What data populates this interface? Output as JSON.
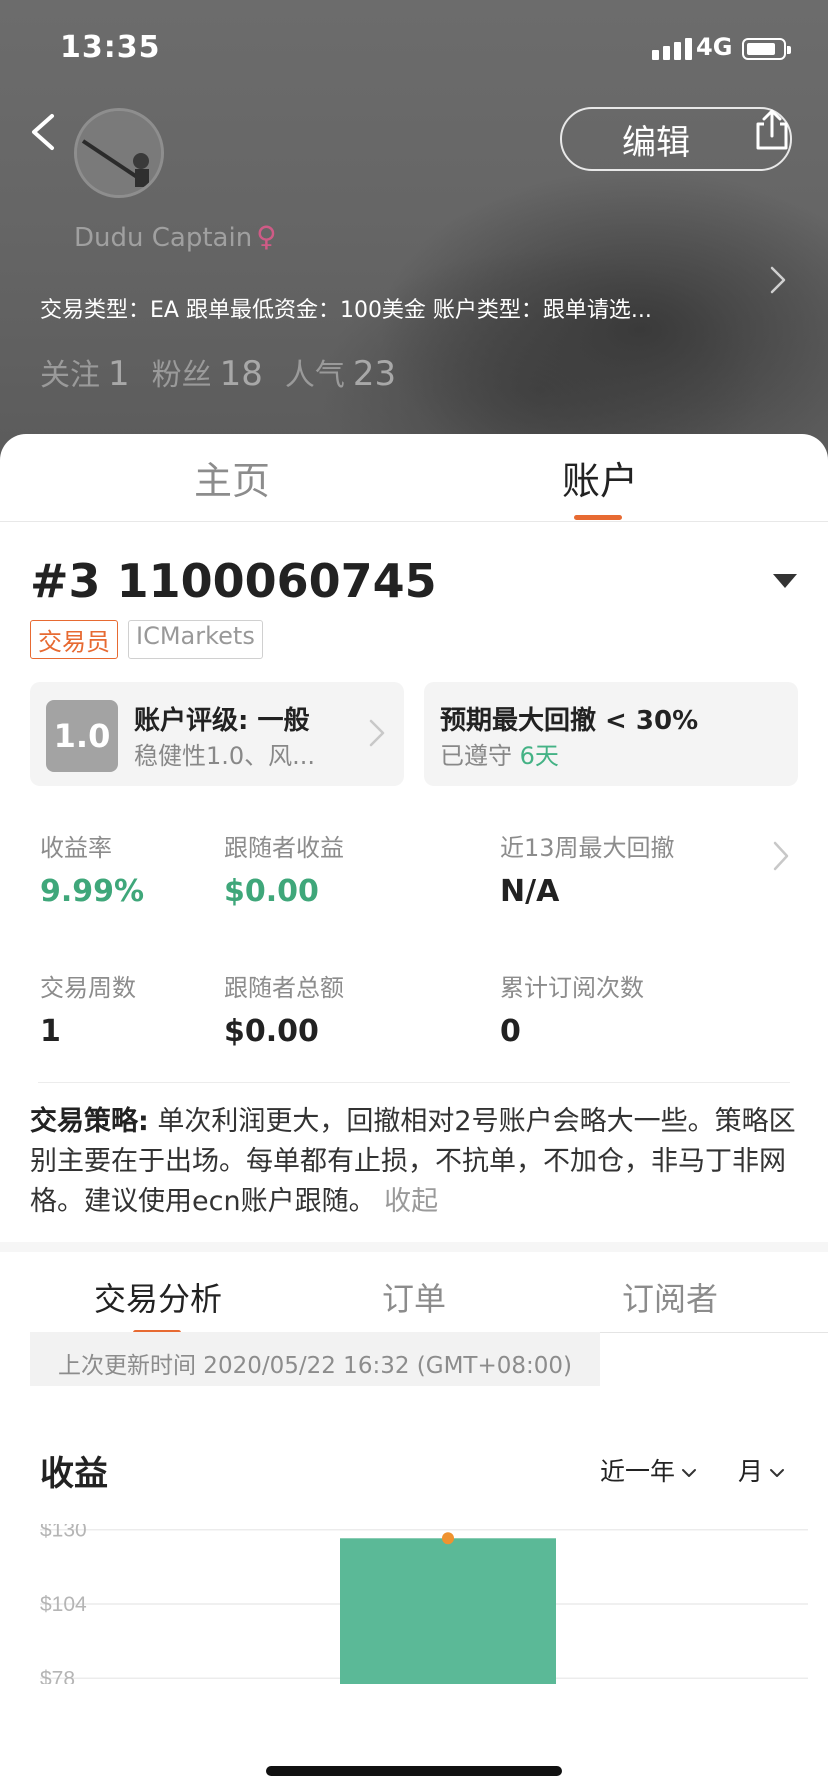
{
  "status_bar": {
    "time": "13:35",
    "network": "4G"
  },
  "header": {
    "edit_label": "编辑",
    "username": "Dudu Captain",
    "gender_symbol": "♀",
    "info_line": "交易类型：EA   跟单最低资金：100美金   账户类型：跟单请选...",
    "stats": [
      {
        "label": "关注",
        "value": "1"
      },
      {
        "label": "粉丝",
        "value": "18"
      },
      {
        "label": "人气",
        "value": "23"
      }
    ]
  },
  "tabs": {
    "home": "主页",
    "account": "账户"
  },
  "account": {
    "number": "#3 1100060745",
    "tags": {
      "role": "交易员",
      "broker": "ICMarkets"
    }
  },
  "rating_card": {
    "score": "1.0",
    "title": "账户评级: 一般",
    "subtitle": "稳健性1.0、风..."
  },
  "drawdown_card": {
    "title": "预期最大回撤 < 30%",
    "kept_label": "已遵守",
    "kept_days": "6天"
  },
  "metrics": {
    "return_rate": {
      "label": "收益率",
      "value": "9.99%"
    },
    "follower_profit": {
      "label": "跟随者收益",
      "value": "$0.00"
    },
    "max_drawdown_13w": {
      "label": "近13周最大回撤",
      "value": "N/A"
    },
    "trading_weeks": {
      "label": "交易周数",
      "value": "1"
    },
    "follower_total": {
      "label": "跟随者总额",
      "value": "$0.00"
    },
    "total_subscriptions": {
      "label": "累计订阅次数",
      "value": "0"
    }
  },
  "strategy": {
    "label": "交易策略:",
    "text": " 单次利润更大，回撤相对2号账户会略大一些。策略区别主要在于出场。每单都有止损，不抗单，不加仓，非马丁非网格。建议使用ecn账户跟随。",
    "collapse_label": "收起"
  },
  "sub_tabs": {
    "analysis": "交易分析",
    "orders": "订单",
    "subscribers": "订阅者"
  },
  "update_info": "上次更新时间 2020/05/22 16:32 (GMT+08:00)",
  "chart_section": {
    "title": "收益",
    "period_select": "近一年",
    "unit_select": "月"
  },
  "chart_data": {
    "type": "bar",
    "categories": [
      ""
    ],
    "values": [
      127
    ],
    "marker_values": [
      127
    ],
    "tick_labels": [
      "$130",
      "$104",
      "$78"
    ],
    "ticks": [
      130,
      104,
      78
    ],
    "ylim_visible": [
      76,
      132
    ],
    "colors": {
      "bar": "#5bb997",
      "marker": "#ef9330",
      "grid": "#ececec",
      "tick": "#b5b5b5"
    }
  }
}
